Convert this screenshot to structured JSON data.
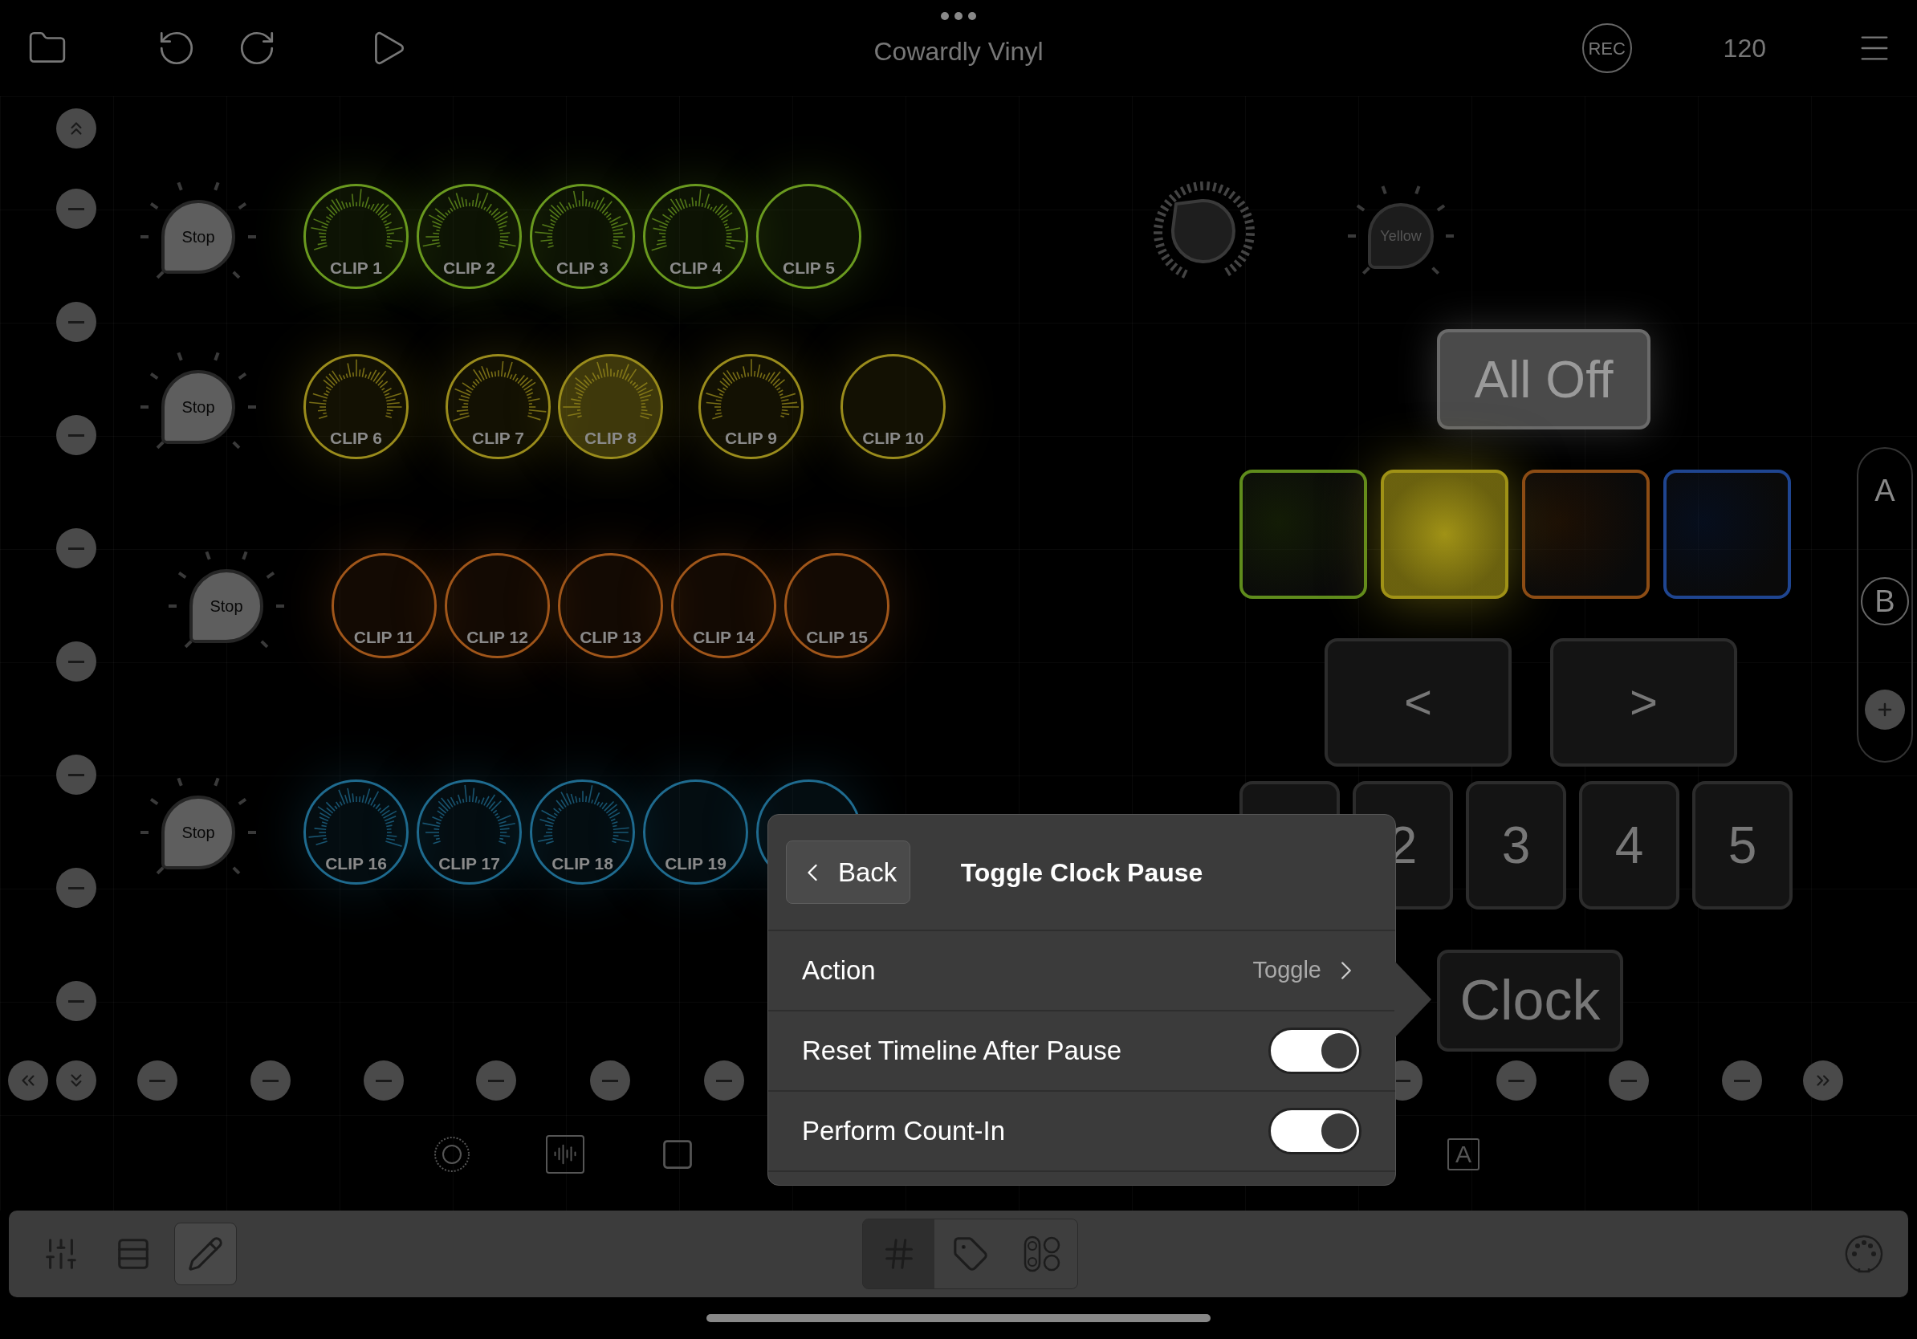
{
  "top_bar": {
    "title": "Cowardly Vinyl",
    "rec_label": "REC",
    "tempo": "120"
  },
  "rows": [
    {
      "color": "#6a9a1f",
      "stop_label": "Stop",
      "clips": [
        {
          "label": "CLIP 1",
          "waveform": true,
          "active": false
        },
        {
          "label": "CLIP 2",
          "waveform": true,
          "active": false
        },
        {
          "label": "CLIP 3",
          "waveform": true,
          "active": false
        },
        {
          "label": "CLIP 4",
          "waveform": true,
          "active": false
        },
        {
          "label": "CLIP 5",
          "waveform": false,
          "active": false
        }
      ]
    },
    {
      "color": "#9a8c1c",
      "stop_label": "Stop",
      "clips": [
        {
          "label": "CLIP 6",
          "waveform": true,
          "active": false
        },
        {
          "label": "CLIP 7",
          "waveform": true,
          "active": false
        },
        {
          "label": "CLIP 8",
          "waveform": true,
          "active": true
        },
        {
          "label": "CLIP 9",
          "waveform": true,
          "active": false
        },
        {
          "label": "CLIP 10",
          "waveform": false,
          "active": false
        }
      ]
    },
    {
      "color": "#a0561a",
      "stop_label": "Stop",
      "clips": [
        {
          "label": "CLIP 11",
          "waveform": false,
          "active": false
        },
        {
          "label": "CLIP 12",
          "waveform": false,
          "active": false
        },
        {
          "label": "CLIP 13",
          "waveform": false,
          "active": false
        },
        {
          "label": "CLIP 14",
          "waveform": false,
          "active": false
        },
        {
          "label": "CLIP 15",
          "waveform": false,
          "active": false
        }
      ]
    },
    {
      "color": "#1f6b8f",
      "stop_label": "Stop",
      "clips": [
        {
          "label": "CLIP 16",
          "waveform": true,
          "active": false
        },
        {
          "label": "CLIP 17",
          "waveform": true,
          "active": false
        },
        {
          "label": "CLIP 18",
          "waveform": true,
          "active": false
        },
        {
          "label": "CLIP 19",
          "waveform": false,
          "active": false
        },
        {
          "waveform": false,
          "active": false
        }
      ]
    }
  ],
  "color_knob": {
    "label": "Yellow"
  },
  "all_off": "All Off",
  "color_pads": [
    {
      "color": "#5f8c1c",
      "selected": false
    },
    {
      "color": "#a09216",
      "selected": true
    },
    {
      "color": "#8c4c14",
      "selected": false
    },
    {
      "color": "#1f4590",
      "selected": false
    }
  ],
  "nav_buttons": [
    "<",
    ">"
  ],
  "number_buttons": [
    "2",
    "3",
    "4",
    "5"
  ],
  "clock_button": "Clock",
  "pages": [
    {
      "label": "A",
      "selected": false
    },
    {
      "label": "B",
      "selected": true
    }
  ],
  "text_tool_label": "A",
  "popover": {
    "back": "Back",
    "title": "Toggle Clock Pause",
    "rows": [
      {
        "kind": "disclosure",
        "label": "Action",
        "value": "Toggle"
      },
      {
        "kind": "toggle",
        "label": "Reset Timeline After Pause",
        "on": true
      },
      {
        "kind": "toggle",
        "label": "Perform Count-In",
        "on": true
      }
    ]
  },
  "toolbar": {
    "left_tools": [
      {
        "selected": false
      },
      {
        "selected": false
      },
      {
        "selected": true
      }
    ],
    "center_tools": [
      {
        "selected": true
      },
      {
        "selected": false
      },
      {
        "selected": false
      }
    ]
  }
}
